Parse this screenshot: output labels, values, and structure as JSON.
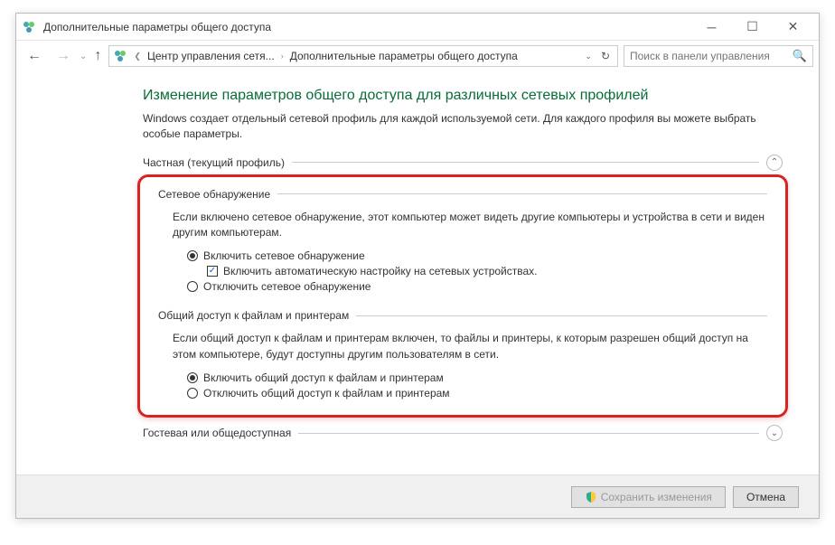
{
  "titlebar": {
    "title": "Дополнительные параметры общего доступа"
  },
  "navbar": {
    "breadcrumb1": "Центр управления сетя...",
    "breadcrumb2": "Дополнительные параметры общего доступа",
    "search_placeholder": "Поиск в панели управления"
  },
  "page": {
    "heading": "Изменение параметров общего доступа для различных сетевых профилей",
    "description": "Windows создает отдельный сетевой профиль для каждой используемой сети. Для каждого профиля вы можете выбрать особые параметры."
  },
  "profiles": {
    "private_label": "Частная (текущий профиль)",
    "guest_label": "Гостевая или общедоступная"
  },
  "discovery": {
    "title": "Сетевое обнаружение",
    "description": "Если включено сетевое обнаружение, этот компьютер может видеть другие компьютеры и устройства в сети и виден другим компьютерам.",
    "radio_on": "Включить сетевое обнаружение",
    "checkbox_auto": "Включить автоматическую настройку на сетевых устройствах.",
    "radio_off": "Отключить сетевое обнаружение"
  },
  "sharing": {
    "title": "Общий доступ к файлам и принтерам",
    "description": "Если общий доступ к файлам и принтерам включен, то файлы и принтеры, к которым разрешен общий доступ на этом компьютере, будут доступны другим пользователям в сети.",
    "radio_on": "Включить общий доступ к файлам и принтерам",
    "radio_off": "Отключить общий доступ к файлам и принтерам"
  },
  "footer": {
    "save": "Сохранить изменения",
    "cancel": "Отмена"
  }
}
